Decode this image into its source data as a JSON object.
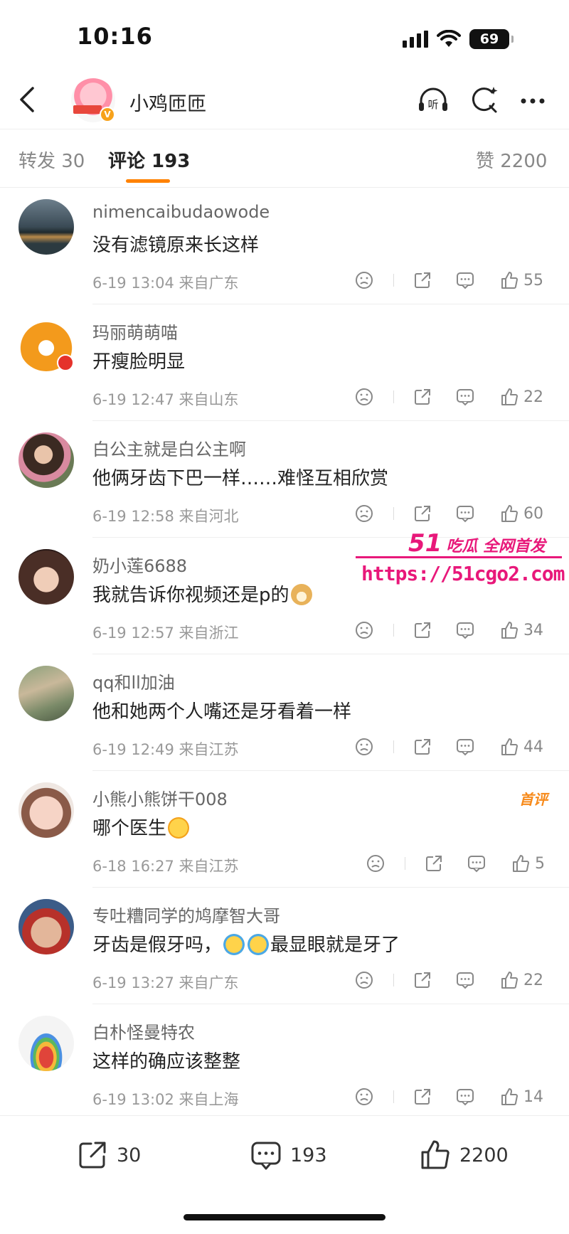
{
  "status_bar": {
    "time": "10:16",
    "battery": "69"
  },
  "header": {
    "title": "小鸡匝匝",
    "verified_badge": "V"
  },
  "tabs": [
    {
      "label": "转发 30"
    },
    {
      "label": "评论 193"
    },
    {
      "label": "赞 2200"
    }
  ],
  "comments": [
    {
      "user": "nimencaibudaowode",
      "text": "没有滤镜原来长这样",
      "meta": "6-19 13:04 来自广东",
      "likes": "55"
    },
    {
      "user": "玛丽萌萌喵",
      "text": "开瘦脸明显",
      "meta": "6-19 12:47 来自山东",
      "likes": "22"
    },
    {
      "user": "白公主就是白公主啊",
      "text": "他俩牙齿下巴一样……难怪互相欣赏",
      "meta": "6-19 12:58 来自河北",
      "likes": "60"
    },
    {
      "user": "奶小莲6688",
      "text": "我就告诉你视频还是p的",
      "meta": "6-19 12:57 来自浙江",
      "likes": "34"
    },
    {
      "user": "qq和ll加油",
      "text": "他和她两个人嘴还是牙看着一样",
      "meta": "6-19 12:49 来自江苏",
      "likes": "44"
    },
    {
      "user": "小熊小熊饼干008",
      "text": "哪个医生",
      "meta": "6-18 16:27 来自江苏",
      "likes": "5",
      "badge": "首评"
    },
    {
      "user": "专吐糟同学的鸠摩智大哥",
      "text_a": "牙齿是假牙吗，",
      "text_b": "最显眼就是牙了",
      "meta": "6-19 13:27 来自广东",
      "likes": "22"
    },
    {
      "user": "白朴怪曼特农",
      "text": "这样的确应该整整",
      "meta": "6-19 13:02 来自上海",
      "likes": "14"
    }
  ],
  "watermark": {
    "logo": "51",
    "logo_text": "吃瓜 全网首发",
    "url": "https://51cgo2.com"
  },
  "bottom_bar": {
    "repost": "30",
    "comment": "193",
    "like": "2200"
  },
  "colors": {
    "accent": "#ff8200",
    "watermark": "#e8187a",
    "first_badge": "#f78a1a"
  }
}
